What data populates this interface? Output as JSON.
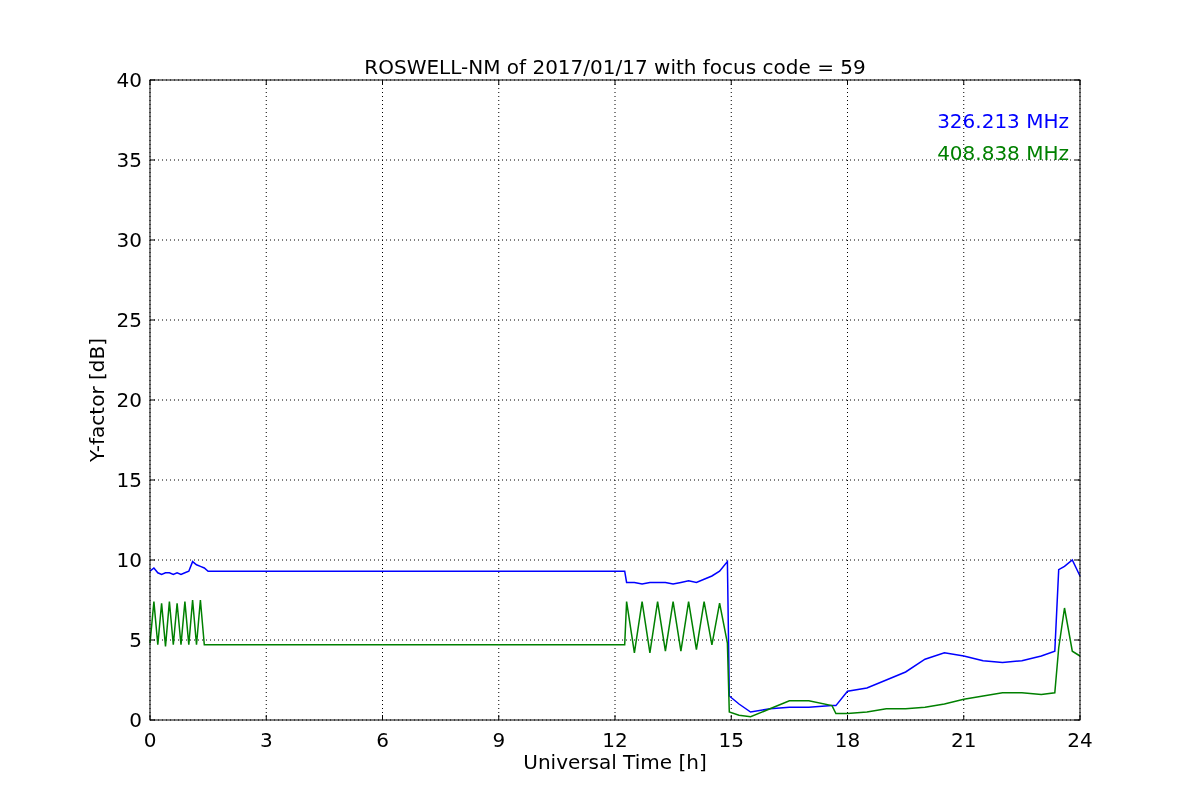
{
  "chart_data": {
    "type": "line",
    "title": "ROSWELL-NM of 2017/01/17 with focus code = 59",
    "xlabel": "Universal Time [h]",
    "ylabel": "Y-factor [dB]",
    "x": [
      0,
      0.1,
      0.2,
      0.3,
      0.4,
      0.5,
      0.6,
      0.7,
      0.8,
      0.9,
      1.0,
      1.1,
      1.2,
      1.3,
      1.4,
      1.5,
      3,
      6,
      9,
      12.25,
      12.3,
      12.5,
      12.7,
      12.9,
      13.1,
      13.3,
      13.5,
      13.7,
      13.9,
      14.1,
      14.3,
      14.5,
      14.7,
      14.9,
      14.95,
      15.2,
      15.5,
      16,
      16.5,
      17,
      17.6,
      17.7,
      18,
      18.5,
      19,
      19.5,
      20,
      20.5,
      21,
      21.5,
      22,
      22.5,
      23,
      23.35,
      23.45,
      23.6,
      23.8,
      24
    ],
    "series": [
      {
        "name": "326.213 MHz",
        "color": "#0000ff",
        "values": [
          9.3,
          9.5,
          9.2,
          9.1,
          9.2,
          9.2,
          9.1,
          9.2,
          9.1,
          9.2,
          9.3,
          9.9,
          9.7,
          9.6,
          9.5,
          9.3,
          9.3,
          9.3,
          9.3,
          9.3,
          8.6,
          8.6,
          8.5,
          8.6,
          8.6,
          8.6,
          8.5,
          8.6,
          8.7,
          8.6,
          8.8,
          9.0,
          9.3,
          9.9,
          1.5,
          1.0,
          0.5,
          0.7,
          0.8,
          0.8,
          0.9,
          0.9,
          1.8,
          2.0,
          2.5,
          3.0,
          3.8,
          4.2,
          4.0,
          3.7,
          3.6,
          3.7,
          4.0,
          4.3,
          9.4,
          9.6,
          10.0,
          9.0
        ]
      },
      {
        "name": "408.838 MHz",
        "color": "#008000",
        "values": [
          4.8,
          7.4,
          4.7,
          7.3,
          4.6,
          7.4,
          4.7,
          7.3,
          4.7,
          7.4,
          4.7,
          7.5,
          4.7,
          7.5,
          4.7,
          4.7,
          4.7,
          4.7,
          4.7,
          4.7,
          7.4,
          4.2,
          7.4,
          4.2,
          7.4,
          4.3,
          7.4,
          4.3,
          7.4,
          4.4,
          7.4,
          4.7,
          7.3,
          4.8,
          0.5,
          0.3,
          0.2,
          0.7,
          1.2,
          1.2,
          0.9,
          0.4,
          0.4,
          0.5,
          0.7,
          0.7,
          0.8,
          1.0,
          1.3,
          1.5,
          1.7,
          1.7,
          1.6,
          1.7,
          4.5,
          7.0,
          4.3,
          4.0
        ]
      }
    ],
    "xlim": [
      0,
      24
    ],
    "ylim": [
      0,
      40
    ],
    "xticks": [
      0,
      3,
      6,
      9,
      12,
      15,
      18,
      21,
      24
    ],
    "yticks": [
      0,
      5,
      10,
      15,
      20,
      25,
      30,
      35,
      40
    ],
    "grid": true
  }
}
